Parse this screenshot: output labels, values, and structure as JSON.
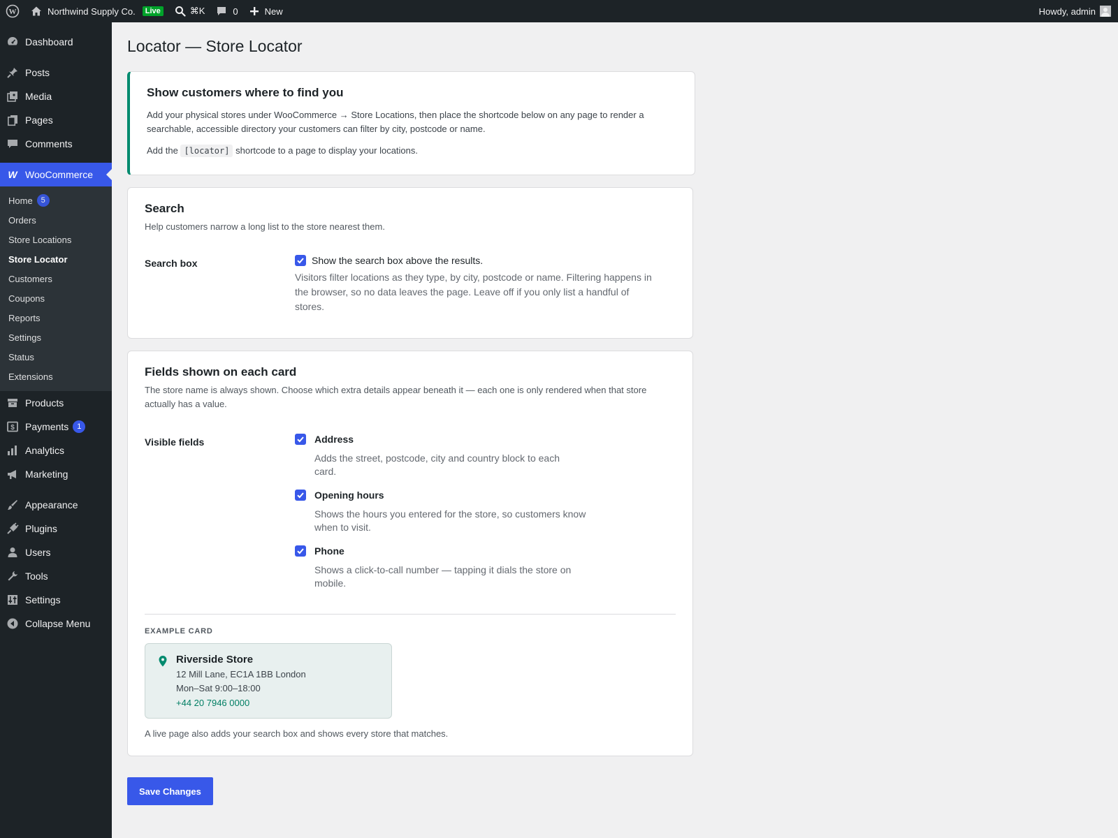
{
  "adminbar": {
    "site_name": "Northwind Supply Co.",
    "live_badge": "Live",
    "search_shortcut": "⌘K",
    "comments_count": "0",
    "new_label": "New",
    "howdy": "Howdy, admin"
  },
  "sidebar": {
    "top_items": [
      {
        "label": "Dashboard",
        "icon": "dashboard-icon"
      }
    ],
    "content_items": [
      {
        "label": "Posts",
        "icon": "pin-icon"
      },
      {
        "label": "Media",
        "icon": "media-icon"
      },
      {
        "label": "Pages",
        "icon": "pages-icon"
      },
      {
        "label": "Comments",
        "icon": "comment-icon"
      }
    ],
    "woocommerce": {
      "label": "WooCommerce",
      "icon": "woocommerce-icon"
    },
    "submenu": [
      {
        "label": "Home",
        "badge": "5"
      },
      {
        "label": "Orders"
      },
      {
        "label": "Store Locations"
      },
      {
        "label": "Store Locator"
      },
      {
        "label": "Customers"
      },
      {
        "label": "Coupons"
      },
      {
        "label": "Reports"
      },
      {
        "label": "Settings"
      },
      {
        "label": "Status"
      },
      {
        "label": "Extensions"
      }
    ],
    "store_items": [
      {
        "label": "Products",
        "icon": "archive-icon"
      },
      {
        "label": "Payments",
        "icon": "payments-icon",
        "badge": "1"
      },
      {
        "label": "Analytics",
        "icon": "analytics-icon"
      },
      {
        "label": "Marketing",
        "icon": "megaphone-icon"
      }
    ],
    "system_items": [
      {
        "label": "Appearance",
        "icon": "brush-icon"
      },
      {
        "label": "Plugins",
        "icon": "plugin-icon"
      },
      {
        "label": "Users",
        "icon": "user-icon"
      },
      {
        "label": "Tools",
        "icon": "wrench-icon"
      },
      {
        "label": "Settings",
        "icon": "settings-icon"
      },
      {
        "label": "Collapse Menu",
        "icon": "collapse-icon"
      }
    ]
  },
  "page": {
    "title": "Locator — Store Locator",
    "intro": {
      "heading": "Show customers where to find you",
      "body": "Add your physical stores under WooCommerce → Store Locations, then place the shortcode below on any page to render a searchable, accessible directory your customers can filter by city, postcode or name.",
      "shortcode_prefix": "Add the",
      "shortcode": "[locator]",
      "shortcode_suffix": "shortcode to a page to display your locations."
    },
    "search": {
      "heading": "Search",
      "description": "Help customers narrow a long list to the store nearest them.",
      "field_label": "Search box",
      "checkbox_label": "Show the search box above the results.",
      "checked": true,
      "help": "Visitors filter locations as they type, by city, postcode or name. Filtering happens in the browser, so no data leaves the page. Leave off if you only list a handful of stores."
    },
    "fields": {
      "heading": "Fields shown on each card",
      "description": "The store name is always shown. Choose which extra details appear beneath it — each one is only rendered when that store actually has a value.",
      "field_label": "Visible fields",
      "options": [
        {
          "label": "Address",
          "checked": true,
          "help": "Adds the street, postcode, city and country block to each card."
        },
        {
          "label": "Opening hours",
          "checked": true,
          "help": "Shows the hours you entered for the store, so customers know when to visit."
        },
        {
          "label": "Phone",
          "checked": true,
          "help": "Shows a click-to-call number — tapping it dials the store on mobile."
        }
      ],
      "example_label": "EXAMPLE CARD",
      "example": {
        "name": "Riverside Store",
        "address": "12 Mill Lane, EC1A 1BB London",
        "hours": "Mon–Sat 9:00–18:00",
        "phone": "+44 20 7946 0000"
      },
      "example_footer": "A live page also adds your search box and shows every store that matches."
    },
    "save_label": "Save Changes"
  },
  "colors": {
    "accent": "#3858e9",
    "brand_green": "#008a6e",
    "admin_dark": "#1d2327"
  }
}
